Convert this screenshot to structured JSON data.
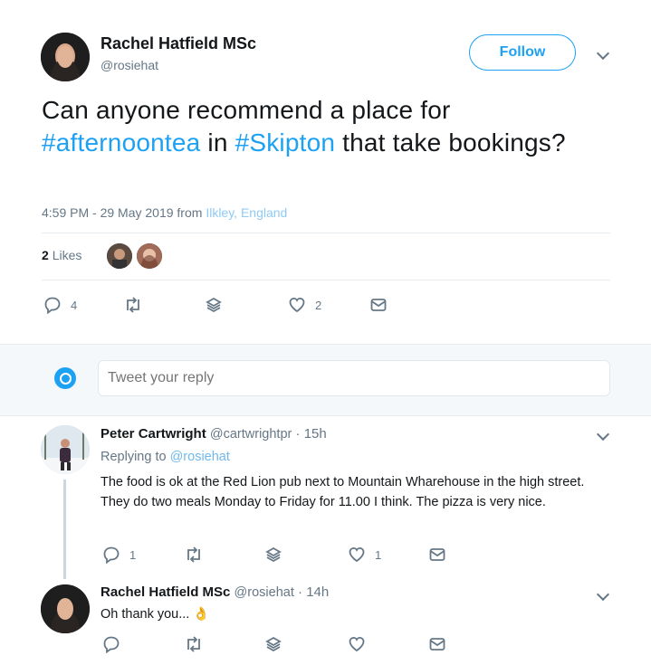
{
  "header": {
    "name": "Rachel Hatfield MSc",
    "handle": "@rosiehat",
    "follow_label": "Follow"
  },
  "tweet": {
    "text_1": "Can anyone recommend a place for",
    "hashtag_1": "#afternoontea",
    "text_2": " in ",
    "hashtag_2": "#Skipton",
    "text_3": " that take bookings?",
    "timestamp": "4:59 PM - 29 May 2019 from ",
    "location": "Ilkley, England",
    "likes_count": "2",
    "likes_label": "Likes",
    "actions": {
      "replies": "4",
      "retweets": "",
      "likes": "2"
    }
  },
  "reply_box": {
    "placeholder": "Tweet your reply"
  },
  "replies": [
    {
      "name": "Peter Cartwright",
      "handle": "@cartwrightpr",
      "sep": " · ",
      "time": "15h",
      "replying_to_label": "Replying to ",
      "replying_to": "@rosiehat",
      "body": "The food is ok at the Red Lion pub next to Mountain Wharehouse in the high street. They do two meals Monday to Friday for 11.00 I think. The pizza is very nice.",
      "actions": {
        "replies": "1",
        "likes": "1"
      }
    },
    {
      "name": "Rachel Hatfield MSc",
      "handle": "@rosiehat",
      "sep": " · ",
      "time": "14h",
      "body": "Oh thank you... ",
      "emoji": "👌",
      "actions": {
        "replies": "",
        "likes": ""
      }
    }
  ],
  "icons": [
    "reply-icon",
    "retweet-icon",
    "stack-icon",
    "heart-icon",
    "message-icon",
    "chevron-down-icon",
    "reply-logo-icon"
  ],
  "colors": {
    "accent": "#1da1f2",
    "muted": "#657786",
    "text": "#14171a",
    "band": "#f5f8fa"
  }
}
